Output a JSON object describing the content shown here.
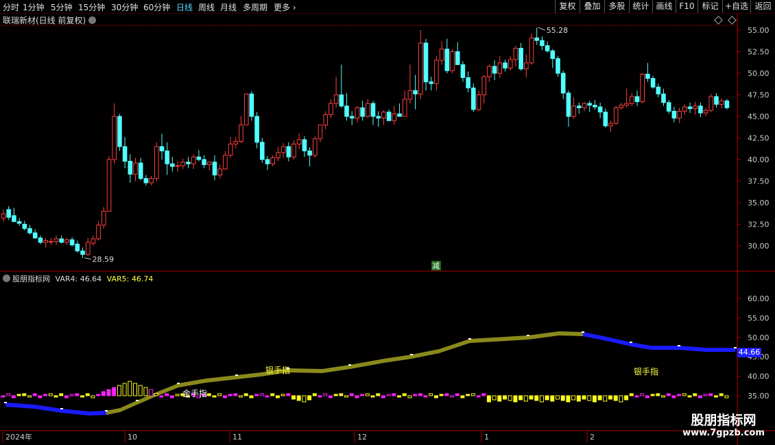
{
  "toolbar": {
    "left_tabs": [
      {
        "label": "分时"
      },
      {
        "label": "1分钟"
      },
      {
        "label": "5分钟"
      },
      {
        "label": "15分钟"
      },
      {
        "label": "30分钟"
      },
      {
        "label": "60分钟"
      },
      {
        "label": "日线"
      },
      {
        "label": "周线"
      },
      {
        "label": "月线"
      },
      {
        "label": "多周期"
      },
      {
        "label": "更多"
      }
    ],
    "active_tab": "日线",
    "right_buttons": [
      {
        "label": "复权"
      },
      {
        "label": "叠加"
      },
      {
        "label": "多股"
      },
      {
        "label": "统计"
      },
      {
        "label": "画线"
      },
      {
        "label": "F10"
      },
      {
        "label": "标记"
      },
      {
        "label": "+自选"
      },
      {
        "label": "返回"
      }
    ]
  },
  "main_panel": {
    "stock_title": "联瑞新材(日线 前复权)",
    "price_axis": [
      "55.00",
      "52.50",
      "50.00",
      "47.50",
      "45.00",
      "42.50",
      "40.00",
      "37.50",
      "35.00",
      "32.50",
      "30.00"
    ],
    "high_marker": "55.28",
    "low_marker": "28.59",
    "signal_label": "减"
  },
  "indicator_panel": {
    "name": "股朋指标网",
    "var4": "VAR4: 46.64",
    "var5": "VAR5: 46.74",
    "axis": [
      "60.00",
      "55.00",
      "50.00",
      "45.00",
      "40.00",
      "35.00"
    ],
    "current_value": "44.66",
    "labels": {
      "gold": "金手指",
      "silver1": "银手指",
      "silver2": "银手指"
    }
  },
  "date_axis": {
    "labels": [
      "2024年",
      "10",
      "11",
      "12",
      "1",
      "2"
    ]
  },
  "watermark": {
    "line1": "股朋指标网",
    "line2": "www.7gpzb.com"
  },
  "colors": {
    "up": "#ff4040",
    "down": "#50ffff",
    "accent": "#5fd0ff",
    "ribbon": "#8a8a1c",
    "magenta": "#ff20ff",
    "yellow": "#ffff20",
    "blue": "#1a1aff"
  },
  "chart_data": {
    "type": "candlestick",
    "candles": [
      [
        33.2,
        34.2,
        32.8,
        33.7
      ],
      [
        34.2,
        34.6,
        33.0,
        33.3
      ],
      [
        33.5,
        34.4,
        32.9,
        32.8
      ],
      [
        32.8,
        33.2,
        32.3,
        32.6
      ],
      [
        32.5,
        32.9,
        31.8,
        32.0
      ],
      [
        32.0,
        32.4,
        31.3,
        31.5
      ],
      [
        31.5,
        31.9,
        30.8,
        30.9
      ],
      [
        30.9,
        31.2,
        30.2,
        30.4
      ],
      [
        30.4,
        30.9,
        29.8,
        30.6
      ],
      [
        30.5,
        30.9,
        30.1,
        30.5
      ],
      [
        30.5,
        31.2,
        30.1,
        30.8
      ],
      [
        30.8,
        31.2,
        30.3,
        30.4
      ],
      [
        30.4,
        30.9,
        30.1,
        30.7
      ],
      [
        30.7,
        31.0,
        29.9,
        30.1
      ],
      [
        30.2,
        30.6,
        29.2,
        29.4
      ],
      [
        29.4,
        29.8,
        28.6,
        29.0
      ],
      [
        29.0,
        30.9,
        28.8,
        30.4
      ],
      [
        30.3,
        31.2,
        30.0,
        30.8
      ],
      [
        30.8,
        32.8,
        30.6,
        32.4
      ],
      [
        32.4,
        34.5,
        32.0,
        34.0
      ],
      [
        34.0,
        40.4,
        34.0,
        40.0
      ],
      [
        40.0,
        46.5,
        39.5,
        45.0
      ],
      [
        45.0,
        45.3,
        41.0,
        41.5
      ],
      [
        41.5,
        42.6,
        39.0,
        39.8
      ],
      [
        39.8,
        40.6,
        37.3,
        38.3
      ],
      [
        38.3,
        40.2,
        37.5,
        39.6
      ],
      [
        39.6,
        40.2,
        37.6,
        37.8
      ],
      [
        37.8,
        38.2,
        37.0,
        37.3
      ],
      [
        37.3,
        38.1,
        37.0,
        37.8
      ],
      [
        37.8,
        42.0,
        37.5,
        41.5
      ],
      [
        41.5,
        43.0,
        40.0,
        41.0
      ],
      [
        41.0,
        42.0,
        38.2,
        39.5
      ],
      [
        39.5,
        40.3,
        38.6,
        39.2
      ],
      [
        39.2,
        39.8,
        38.6,
        39.3
      ],
      [
        39.3,
        40.1,
        38.9,
        39.7
      ],
      [
        39.7,
        40.3,
        39.0,
        39.5
      ],
      [
        39.5,
        40.6,
        38.9,
        40.3
      ],
      [
        40.3,
        41.1,
        39.8,
        40.0
      ],
      [
        40.0,
        40.5,
        39.0,
        39.4
      ],
      [
        39.4,
        39.8,
        38.7,
        39.7
      ],
      [
        39.7,
        40.5,
        37.6,
        38.2
      ],
      [
        38.2,
        39.4,
        37.8,
        38.9
      ],
      [
        38.9,
        41.0,
        38.8,
        40.5
      ],
      [
        40.5,
        42.6,
        40.2,
        41.8
      ],
      [
        41.8,
        42.6,
        41.3,
        42.1
      ],
      [
        42.1,
        45.0,
        41.9,
        44.0
      ],
      [
        44.0,
        47.6,
        44.0,
        47.6
      ],
      [
        47.6,
        47.9,
        44.5,
        45.0
      ],
      [
        45.0,
        45.5,
        41.3,
        42.0
      ],
      [
        42.0,
        42.5,
        39.6,
        40.0
      ],
      [
        40.0,
        40.4,
        38.8,
        39.5
      ],
      [
        39.5,
        40.5,
        39.2,
        40.2
      ],
      [
        40.2,
        41.5,
        39.8,
        40.8
      ],
      [
        40.8,
        41.9,
        40.2,
        41.5
      ],
      [
        41.5,
        42.0,
        39.8,
        40.3
      ],
      [
        40.3,
        42.2,
        40.0,
        41.8
      ],
      [
        41.8,
        43.0,
        41.2,
        42.3
      ],
      [
        42.3,
        42.7,
        40.3,
        41.0
      ],
      [
        41.0,
        41.4,
        39.2,
        40.5
      ],
      [
        40.5,
        42.7,
        40.2,
        42.4
      ],
      [
        42.4,
        44.0,
        42.0,
        44.0
      ],
      [
        44.0,
        45.6,
        43.5,
        45.2
      ],
      [
        45.2,
        47.0,
        44.8,
        46.5
      ],
      [
        46.5,
        49.6,
        46.0,
        47.5
      ],
      [
        47.5,
        51.0,
        46.0,
        46.2
      ],
      [
        46.2,
        47.7,
        44.5,
        45.0
      ],
      [
        45.0,
        45.6,
        44.0,
        44.8
      ],
      [
        44.8,
        46.2,
        44.3,
        46.0
      ],
      [
        46.0,
        46.8,
        44.5,
        45.0
      ],
      [
        45.0,
        47.0,
        44.8,
        46.5
      ],
      [
        46.5,
        46.8,
        44.0,
        45.0
      ],
      [
        45.0,
        45.6,
        43.8,
        44.8
      ],
      [
        44.8,
        45.7,
        44.0,
        45.5
      ],
      [
        45.5,
        45.8,
        44.5,
        44.5
      ],
      [
        44.5,
        46.2,
        44.0,
        45.3
      ],
      [
        45.3,
        46.5,
        45.0,
        45.0
      ],
      [
        45.0,
        48.0,
        46.0,
        47.0
      ],
      [
        47.0,
        51.0,
        46.5,
        48.0
      ],
      [
        48.0,
        49.8,
        45.8,
        47.6
      ],
      [
        47.6,
        55.0,
        47.0,
        53.5
      ],
      [
        53.5,
        54.0,
        48.0,
        49.0
      ],
      [
        49.0,
        49.6,
        48.0,
        48.8
      ],
      [
        48.8,
        52.0,
        48.0,
        51.5
      ],
      [
        51.5,
        53.7,
        51.0,
        52.8
      ],
      [
        52.8,
        54.0,
        50.0,
        50.3
      ],
      [
        50.3,
        52.8,
        50.0,
        52.5
      ],
      [
        52.5,
        53.6,
        51.0,
        51.0
      ],
      [
        51.0,
        51.4,
        49.0,
        49.5
      ],
      [
        49.5,
        50.2,
        47.8,
        48.3
      ],
      [
        48.3,
        48.8,
        45.5,
        45.8
      ],
      [
        45.8,
        48.0,
        45.6,
        47.5
      ],
      [
        47.5,
        49.8,
        46.5,
        49.6
      ],
      [
        49.6,
        51.0,
        49.0,
        50.8
      ],
      [
        50.8,
        51.5,
        49.2,
        50.0
      ],
      [
        50.0,
        52.0,
        49.5,
        51.2
      ],
      [
        51.2,
        51.6,
        50.2,
        50.6
      ],
      [
        50.6,
        52.0,
        50.3,
        51.6
      ],
      [
        51.6,
        53.2,
        50.8,
        52.9
      ],
      [
        52.9,
        53.5,
        50.3,
        50.5
      ],
      [
        50.5,
        52.2,
        49.5,
        51.2
      ],
      [
        51.2,
        54.6,
        51.0,
        54.1
      ],
      [
        54.1,
        55.3,
        53.3,
        53.8
      ],
      [
        53.8,
        54.3,
        52.7,
        53.2
      ],
      [
        53.2,
        53.7,
        52.4,
        52.6
      ],
      [
        52.6,
        52.8,
        50.6,
        51.7
      ],
      [
        51.7,
        52.0,
        49.6,
        50.0
      ],
      [
        50.0,
        50.3,
        47.0,
        47.7
      ],
      [
        47.7,
        48.0,
        43.8,
        45.0
      ],
      [
        45.0,
        47.2,
        44.7,
        46.2
      ],
      [
        46.2,
        46.6,
        45.3,
        46.0
      ],
      [
        46.0,
        46.7,
        45.6,
        46.5
      ],
      [
        46.5,
        46.8,
        45.5,
        46.3
      ],
      [
        46.3,
        46.9,
        45.8,
        46.1
      ],
      [
        46.1,
        46.6,
        44.8,
        45.5
      ],
      [
        45.5,
        45.9,
        43.7,
        43.9
      ],
      [
        43.9,
        44.5,
        43.2,
        44.2
      ],
      [
        44.2,
        46.2,
        44.0,
        46.0
      ],
      [
        46.0,
        46.6,
        45.8,
        46.3
      ],
      [
        46.3,
        48.2,
        46.0,
        46.5
      ],
      [
        46.5,
        47.7,
        46.2,
        47.3
      ],
      [
        47.3,
        48.0,
        46.2,
        46.7
      ],
      [
        46.7,
        50.0,
        46.5,
        49.9
      ],
      [
        49.9,
        51.2,
        49.0,
        49.4
      ],
      [
        49.4,
        49.7,
        48.2,
        48.4
      ],
      [
        48.4,
        48.8,
        47.2,
        47.6
      ],
      [
        47.6,
        48.2,
        46.2,
        46.6
      ],
      [
        46.6,
        46.9,
        45.3,
        45.6
      ],
      [
        45.6,
        46.1,
        44.3,
        44.8
      ],
      [
        44.8,
        46.0,
        44.2,
        45.6
      ],
      [
        45.6,
        46.4,
        45.2,
        46.1
      ],
      [
        46.1,
        46.6,
        45.4,
        45.9
      ],
      [
        45.9,
        46.7,
        45.2,
        46.2
      ],
      [
        46.2,
        46.6,
        44.9,
        45.4
      ],
      [
        45.4,
        46.0,
        45.0,
        45.7
      ],
      [
        45.7,
        47.6,
        45.5,
        47.3
      ],
      [
        47.3,
        47.7,
        46.0,
        46.4
      ],
      [
        46.4,
        47.1,
        45.9,
        46.8
      ],
      [
        46.8,
        47.0,
        45.8,
        46.0
      ]
    ]
  }
}
